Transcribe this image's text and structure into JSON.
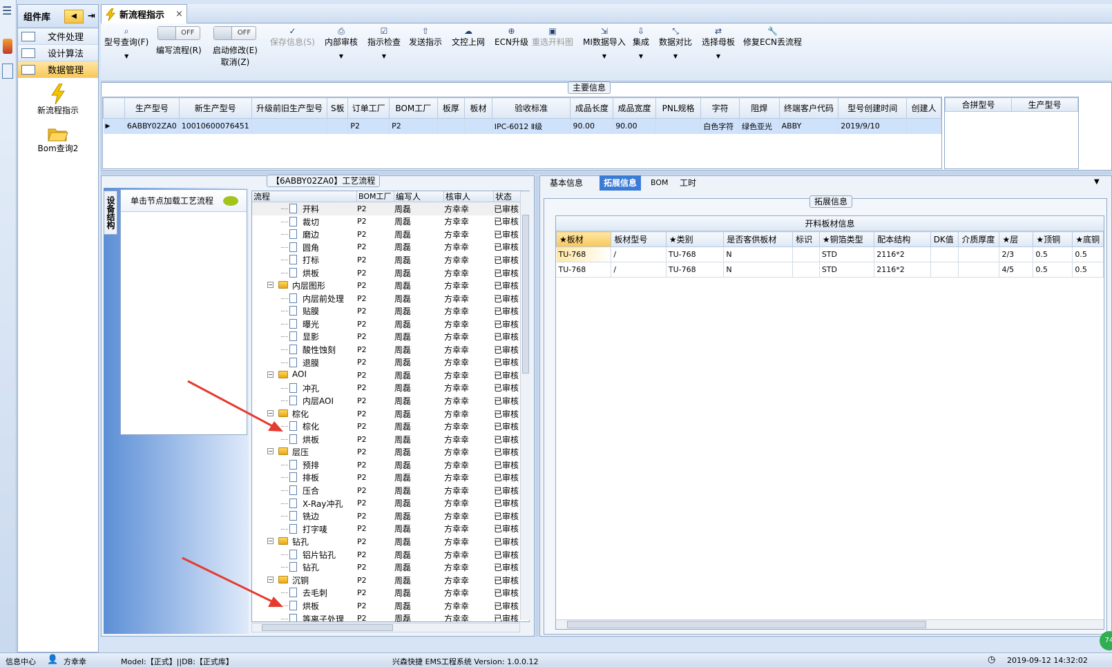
{
  "nav": {
    "title": "组件库",
    "items": [
      "文件处理",
      "设计算法",
      "数据管理"
    ],
    "tools": [
      {
        "label": "新流程指示",
        "icon": "lightning-icon"
      },
      {
        "label": "Bom查询2",
        "icon": "folder-open-icon"
      }
    ]
  },
  "tab": {
    "title": "新流程指示",
    "close": "×"
  },
  "toolbar": {
    "query": "型号查询(F)",
    "toggle_off": "OFF",
    "write_flow": "编写流程(R)",
    "start_modify": "启动修改(E)",
    "cancel": "取消(Z)",
    "save": "保存信息(S)",
    "internal_review": "内部审核",
    "instruction_check": "指示检查",
    "send_instruction": "发送指示",
    "doc_online": "文控上网",
    "ecn_upgrade": "ECN升级",
    "reselect_image": "重选开料图",
    "mi_import": "MI数据导入",
    "integrate": "集成",
    "compare": "数据对比",
    "select_mother": "选择母板",
    "repair_ecn": "修复ECN丢流程"
  },
  "main_info": {
    "legend": "主要信息",
    "columns": [
      "生产型号",
      "新生产型号",
      "升级前旧生产型号",
      "S板",
      "订单工厂",
      "BOM工厂",
      "板厚",
      "板材",
      "验收标准",
      "成品长度",
      "成品宽度",
      "PNL规格",
      "字符",
      "阻焊",
      "终端客户代码",
      "型号创建时间",
      "创建人"
    ],
    "row": [
      "6ABBY02ZA0",
      "10010600076451",
      "",
      "",
      "P2",
      "P2",
      "",
      "",
      "IPC-6012 Ⅱ级",
      "90.00",
      "90.00",
      "",
      "白色字符",
      "绿色亚光",
      "ABBY",
      "2019/9/10",
      ""
    ],
    "merge_columns": [
      "合拼型号",
      "生产型号"
    ]
  },
  "left_panel": {
    "vertical_tab": "设备结构",
    "hint": "单击节点加载工艺流程"
  },
  "process": {
    "legend": "【6ABBY02ZA0】工艺流程",
    "columns": [
      "流程",
      "BOM工厂",
      "编写人",
      "核审人",
      "状态"
    ],
    "rows": [
      {
        "name": "开料",
        "level": 2
      },
      {
        "name": "裁切",
        "level": 2
      },
      {
        "name": "磨边",
        "level": 2
      },
      {
        "name": "圆角",
        "level": 2
      },
      {
        "name": "打标",
        "level": 2
      },
      {
        "name": "烘板",
        "level": 2
      },
      {
        "name": "内层图形",
        "level": 1
      },
      {
        "name": "内层前处理",
        "level": 2
      },
      {
        "name": "贴膜",
        "level": 2
      },
      {
        "name": "曝光",
        "level": 2
      },
      {
        "name": "显影",
        "level": 2
      },
      {
        "name": "酸性蚀刻",
        "level": 2
      },
      {
        "name": "退膜",
        "level": 2
      },
      {
        "name": "AOI",
        "level": 1
      },
      {
        "name": "冲孔",
        "level": 2
      },
      {
        "name": "内层AOI",
        "level": 2
      },
      {
        "name": "棕化",
        "level": 1
      },
      {
        "name": "棕化",
        "level": 2
      },
      {
        "name": "烘板",
        "level": 2
      },
      {
        "name": "层压",
        "level": 1
      },
      {
        "name": "预排",
        "level": 2
      },
      {
        "name": "排板",
        "level": 2
      },
      {
        "name": "压合",
        "level": 2
      },
      {
        "name": "X-Ray冲孔",
        "level": 2
      },
      {
        "name": "铣边",
        "level": 2
      },
      {
        "name": "打字唛",
        "level": 2
      },
      {
        "name": "钻孔",
        "level": 1
      },
      {
        "name": "铝片钻孔",
        "level": 2
      },
      {
        "name": "钻孔",
        "level": 2
      },
      {
        "name": "沉铜",
        "level": 1
      },
      {
        "name": "去毛刺",
        "level": 2
      },
      {
        "name": "烘板",
        "level": 2
      },
      {
        "name": "等离子处理",
        "level": 2
      }
    ],
    "bom_factory": "P2",
    "writer": "周磊",
    "reviewer": "方幸幸",
    "status": "已审核"
  },
  "right_tabs": [
    "基本信息",
    "拓展信息",
    "BOM",
    "工时"
  ],
  "ext": {
    "legend": "拓展信息",
    "table_title": "开料板材信息",
    "columns": [
      "★板材",
      "板材型号",
      "★类别",
      "是否客供板材",
      "标识",
      "★铜箔类型",
      "配本结构",
      "DK值",
      "介质厚度",
      "★层",
      "★顶铜",
      "★底铜"
    ],
    "rows": [
      [
        "TU-768",
        "/",
        "TU-768",
        "N",
        "",
        "STD",
        "2116*2",
        "",
        "",
        "2/3",
        "0.5",
        "0.5"
      ],
      [
        "TU-768",
        "/",
        "TU-768",
        "N",
        "",
        "STD",
        "2116*2",
        "",
        "",
        "4/5",
        "0.5",
        "0.5"
      ]
    ]
  },
  "status_bar": {
    "center": "信息中心",
    "user": "方幸幸",
    "model": "Model:【正式】||DB:【正式库】",
    "system": "兴森快捷 EMS工程系统 Version: 1.0.0.12",
    "time": "2019-09-12 14:32:02",
    "badge": "74"
  },
  "colors": {
    "accent": "#f8c75a",
    "arrow": "#e53a2f",
    "selected_tab": "#3a7bd5"
  }
}
